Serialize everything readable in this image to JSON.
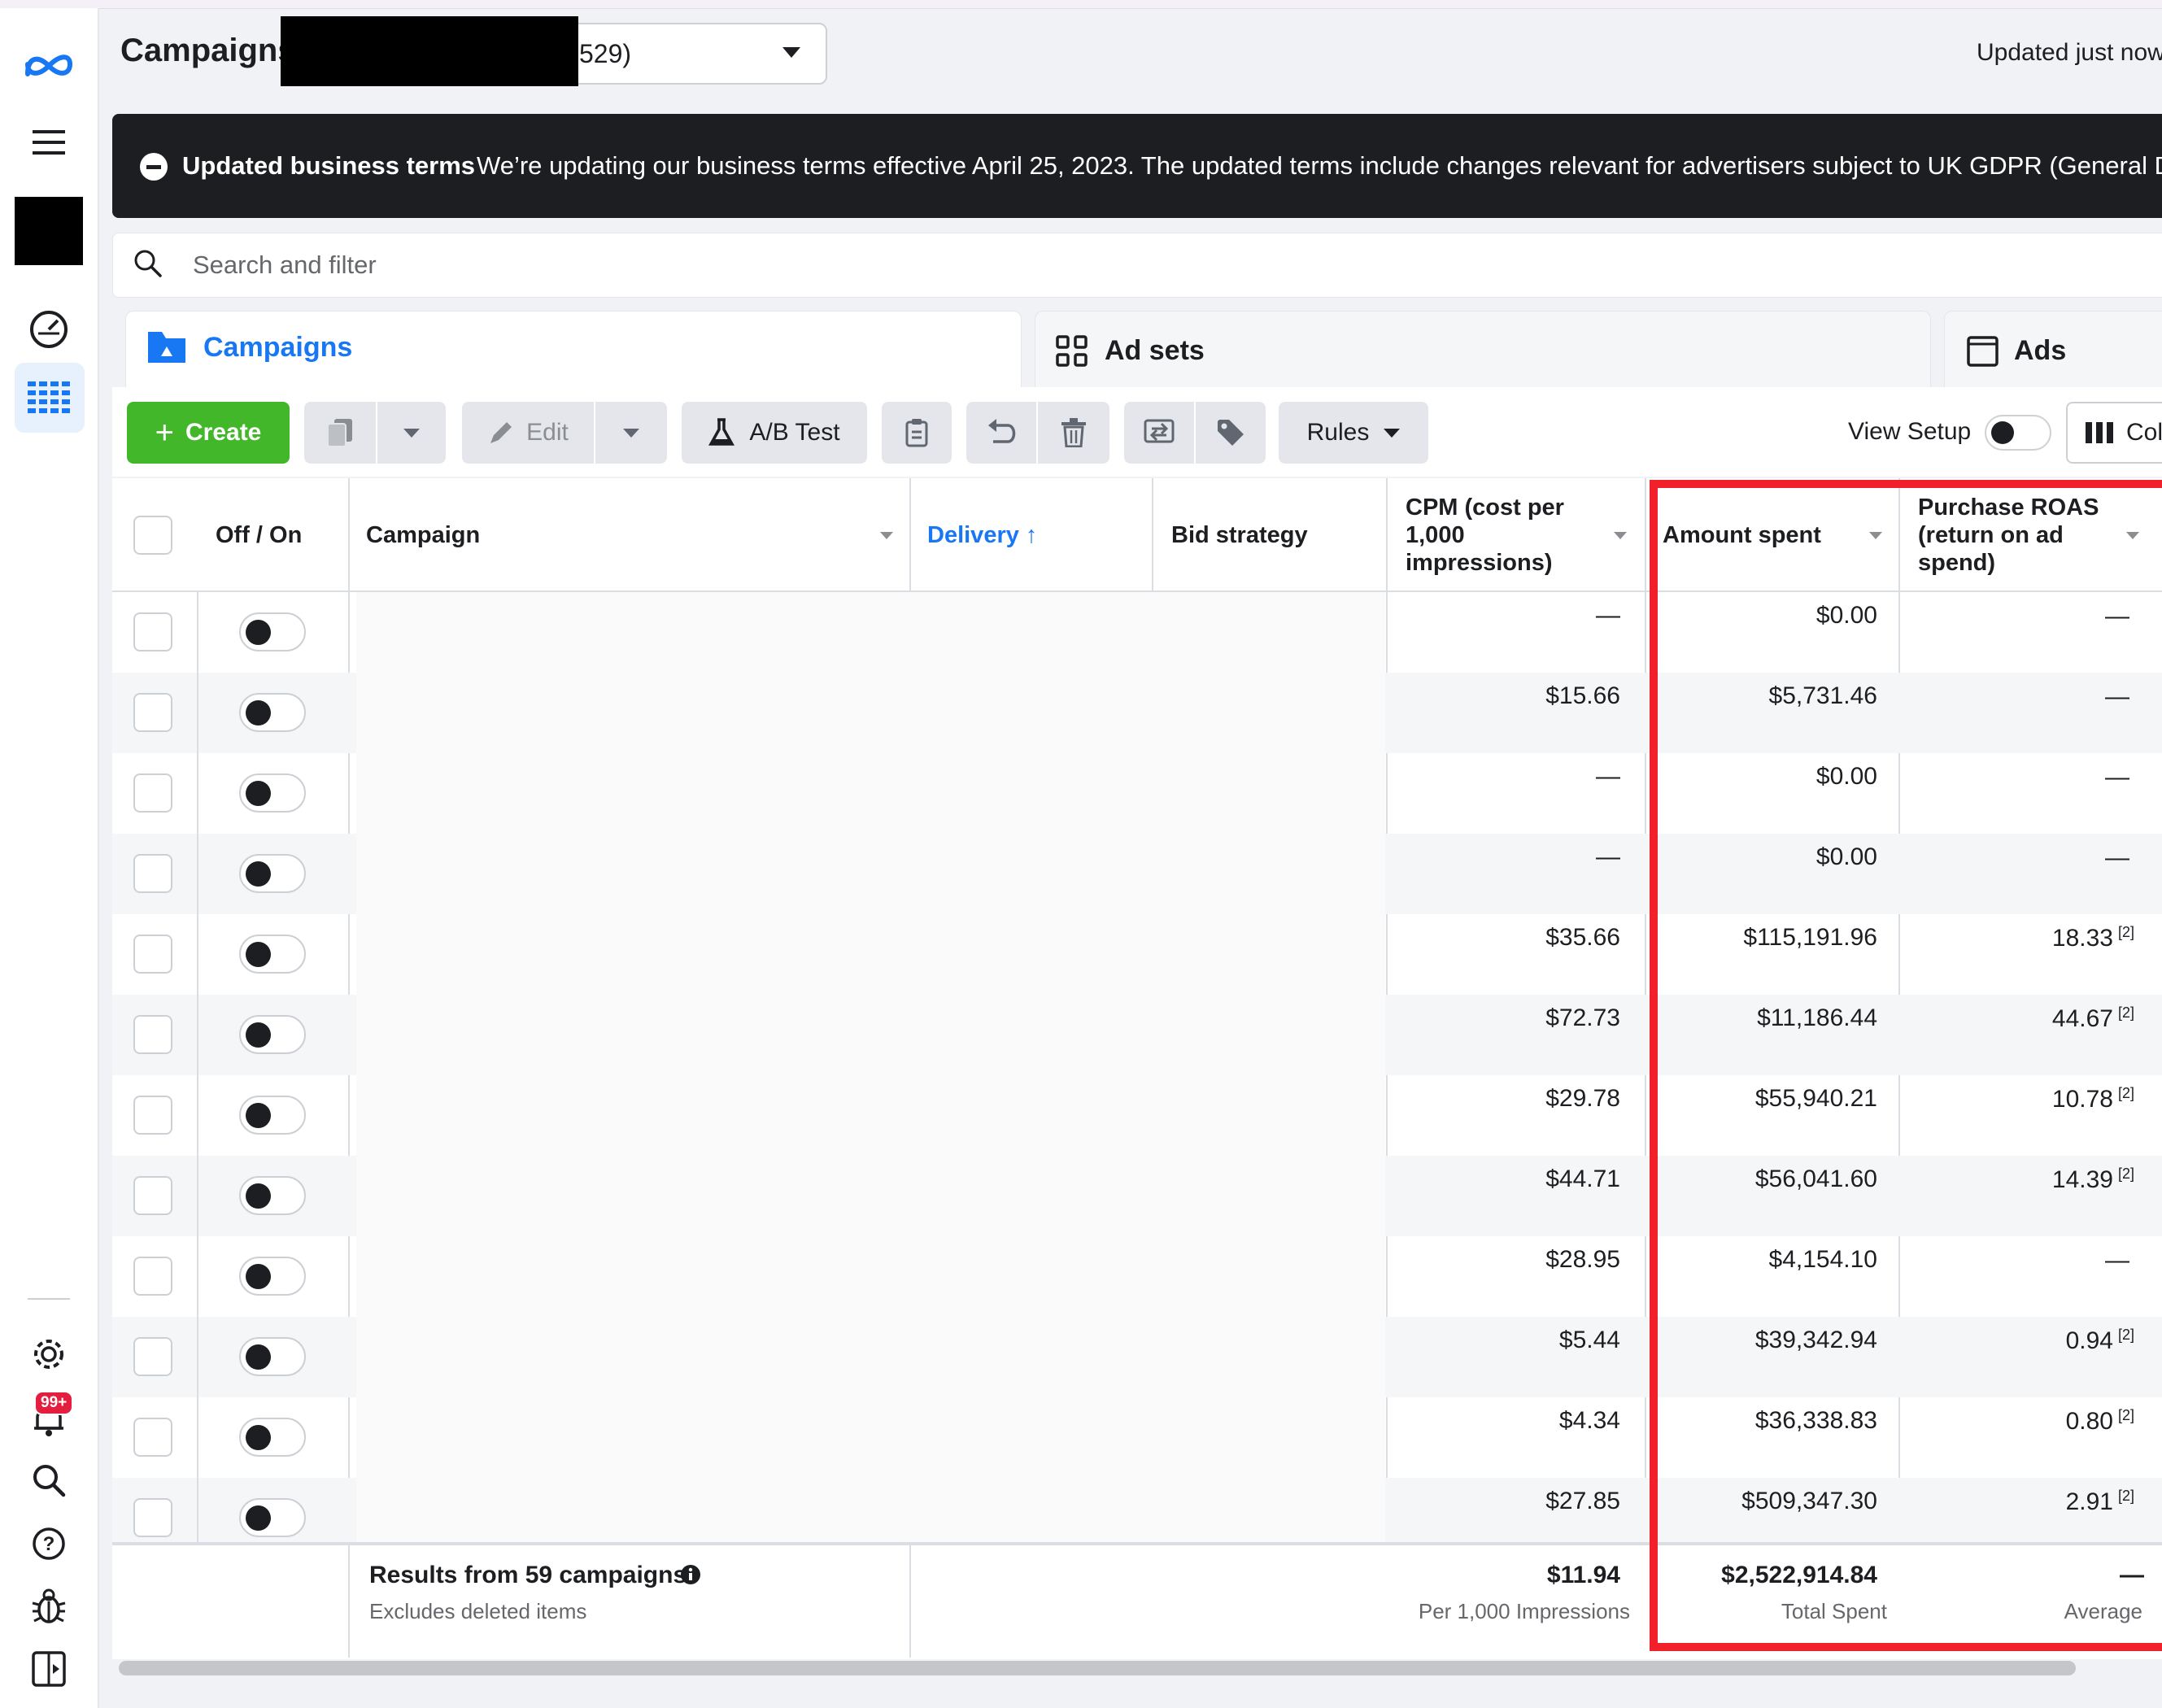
{
  "app": {
    "title": "Campaigns",
    "account_suffix": "529)",
    "status": "Updated just now"
  },
  "banner": {
    "bold": "Updated business terms",
    "text": "We’re updating our business terms effective April 25, 2023. The updated terms include changes relevant for advertisers subject to UK GDPR (General Data P"
  },
  "search": {
    "placeholder": "Search and filter"
  },
  "tabs": [
    {
      "label": "Campaigns",
      "icon": "folder-icon",
      "active": true
    },
    {
      "label": "Ad sets",
      "icon": "grid-icon",
      "active": false
    },
    {
      "label": "Ads",
      "icon": "window-icon",
      "active": false
    }
  ],
  "toolbar": {
    "create": "Create",
    "edit": "Edit",
    "ab_test": "A/B Test",
    "rules": "Rules",
    "view_setup": "View Setup",
    "columns": "Col"
  },
  "nav": {
    "badge": "99+"
  },
  "table": {
    "headers": {
      "off_on": "Off / On",
      "campaign": "Campaign",
      "delivery": "Delivery ↑",
      "bid_strategy": "Bid strategy",
      "cpm_1": "CPM (cost per",
      "cpm_2": "1,000",
      "cpm_3": "impressions)",
      "amount_spent": "Amount spent",
      "roas_1": "Purchase ROAS",
      "roas_2": "(return on ad",
      "roas_3": "spend)"
    },
    "rows": [
      {
        "cpm": "—",
        "spent": "$0.00",
        "roas": "—",
        "note": ""
      },
      {
        "cpm": "$15.66",
        "spent": "$5,731.46",
        "roas": "—",
        "note": ""
      },
      {
        "cpm": "—",
        "spent": "$0.00",
        "roas": "—",
        "note": ""
      },
      {
        "cpm": "—",
        "spent": "$0.00",
        "roas": "—",
        "note": ""
      },
      {
        "cpm": "$35.66",
        "spent": "$115,191.96",
        "roas": "18.33",
        "note": "[2]"
      },
      {
        "cpm": "$72.73",
        "spent": "$11,186.44",
        "roas": "44.67",
        "note": "[2]"
      },
      {
        "cpm": "$29.78",
        "spent": "$55,940.21",
        "roas": "10.78",
        "note": "[2]"
      },
      {
        "cpm": "$44.71",
        "spent": "$56,041.60",
        "roas": "14.39",
        "note": "[2]"
      },
      {
        "cpm": "$28.95",
        "spent": "$4,154.10",
        "roas": "—",
        "note": ""
      },
      {
        "cpm": "$5.44",
        "spent": "$39,342.94",
        "roas": "0.94",
        "note": "[2]"
      },
      {
        "cpm": "$4.34",
        "spent": "$36,338.83",
        "roas": "0.80",
        "note": "[2]"
      },
      {
        "cpm": "$27.85",
        "spent": "$509,347.30",
        "roas": "2.91",
        "note": "[2]"
      }
    ],
    "footer": {
      "results": "Results from 59 campaigns",
      "excludes": "Excludes deleted items",
      "cpm": "$11.94",
      "cpm_sub": "Per 1,000 Impressions",
      "spent": "$2,522,914.84",
      "spent_sub": "Total Spent",
      "roas": "—",
      "roas_sub": "Average"
    }
  },
  "colors": {
    "accent": "#1877f2",
    "create": "#42b72a",
    "highlight": "#f2202a",
    "banner": "#1c1e21"
  }
}
